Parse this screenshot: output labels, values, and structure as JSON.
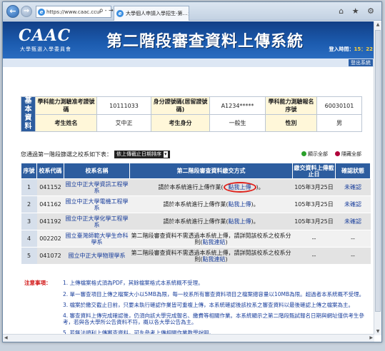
{
  "browser": {
    "url": "https://www.caac.ccu",
    "addr_controls": "ρ - →",
    "tab_title": "大學個人申請入學招生-第…",
    "tab_close": "×",
    "right_icons": "⌂ ★ ⚙"
  },
  "site": {
    "logo": "CAAC",
    "logo_sub": "大學甄選入學委員會",
    "title": "第二階段審查資料上傳系統",
    "login_label": "登入時間：",
    "login_value": "15：22",
    "logout": "登出系統"
  },
  "info": {
    "side_label": "基本資料",
    "row1": {
      "l1": "學科能力測驗准考證號碼",
      "v1": "10111033",
      "l2": "身分證號碼(居留證號碼)",
      "v2": "A1234*****",
      "l3": "學科能力測驗報名序號",
      "v3": "60030101"
    },
    "row2": {
      "l1": "考生姓名",
      "v1": "艾中正",
      "l2": "考生身分",
      "v2": "一般生",
      "l3": "性別",
      "v3": "男"
    }
  },
  "filter": {
    "label": "您通過第一階段篩選之校系如下表：",
    "select_value": "依上傳截止日期排序",
    "select_chevron": "▾",
    "show_all": "顯示全部",
    "hide_all": "隱藏全部"
  },
  "table": {
    "headers": {
      "idx": "序號",
      "code": "校系代碼",
      "name": "校系名稱",
      "method": "第二階段審查資料繳交方式",
      "deadline": "繳交資料上傳截止日",
      "status": "確認狀態"
    },
    "rows": [
      {
        "idx": "1",
        "code": "041152",
        "name": "國立中正大學資訊工程學系",
        "method_pre": "請於本系統進行上傳作業(",
        "method_link": "點我上傳",
        "method_post": ")。",
        "deadline": "105年3月25日",
        "status": "未確認",
        "highlight": true
      },
      {
        "idx": "2",
        "code": "041162",
        "name": "國立中正大學電機工程學系",
        "method_pre": "請於本系統進行上傳作業(",
        "method_link": "點我上傳",
        "method_post": ")。",
        "deadline": "105年3月25日",
        "status": "未確認"
      },
      {
        "idx": "3",
        "code": "041192",
        "name": "國立中正大學化學工程學系",
        "method_pre": "請於本系統進行上傳作業(",
        "method_link": "點我上傳",
        "method_post": ")。",
        "deadline": "105年3月25日",
        "status": "未確認"
      },
      {
        "idx": "4",
        "code": "002202",
        "name": "國立臺灣師範大學生命科學系",
        "method_pre": "第二階段審查資料不需透過本系統上傳，請詳閱該校系之校系分則(",
        "method_link": "點我連結",
        "method_post": ")",
        "deadline": "--",
        "status": "--"
      },
      {
        "idx": "5",
        "code": "041072",
        "name": "國立中正大學物理學系",
        "method_pre": "第二階段審查資料不需透過本系統上傳，請詳閱該校系之校系分則(",
        "method_link": "點我連結",
        "method_post": ")",
        "deadline": "--",
        "status": "--"
      }
    ]
  },
  "notes": {
    "title": "注意事項：",
    "items": [
      "1. 上傳檔案格式須為PDF，其餘檔案格式本系統概不受理。",
      "2. 單一審查項目上傳之檔案大小以5MB為限，每一校系所有審查資料項目之檔案總容量以10MB為限。超過者本系統概不受理。",
      "3. 檔案於繳交截止日前，只要未執行確認作業皆可重複上傳，本系統確認後該校系之審查資料以最後確認上傳之檔案為主。",
      "4. 審查資料上傳完成確認後，仍須向該大學完成報名、繳費等相關作業。本系統顯示之第二階段甄試報名日期與網址僅供考生參考，若與各大學所公告資料不符，概以各大學公告為主。",
      "5. 若無法順利上傳審查資料，可先參考上傳相關作業教學說明。"
    ]
  },
  "colors": {
    "header_blue": "#2d5d9f",
    "label_yellow": "#fff7d9",
    "note_red": "#d01010",
    "highlight_ring": "#e0201a"
  }
}
